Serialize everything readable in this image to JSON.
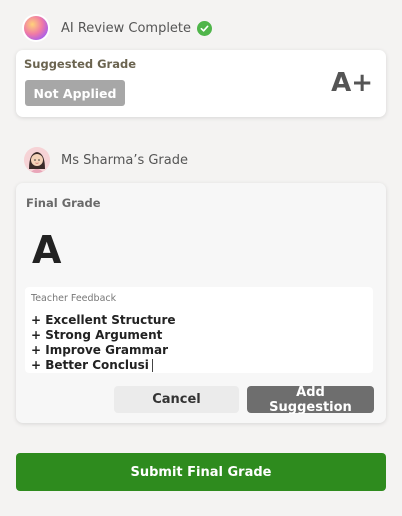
{
  "ai_review": {
    "status": "AI Review Complete"
  },
  "suggestion": {
    "label": "Suggested Grade",
    "status_badge": "Not Applied",
    "grade": "A+"
  },
  "teacher": {
    "name_label": "Ms Sharma’s Grade"
  },
  "final": {
    "label": "Final Grade",
    "grade": "A",
    "feedback_label": "Teacher Feedback",
    "feedback_lines": [
      "+ Excellent Structure",
      "+ Strong Argument",
      "+ Improve Grammar",
      "+ Better Conclusi"
    ]
  },
  "actions": {
    "cancel": "Cancel",
    "add_suggestion": "Add Suggestion",
    "submit": "Submit Final Grade"
  },
  "colors": {
    "success": "#4fb54a",
    "primary": "#2e8b1e",
    "muted_button": "#6e6e6e",
    "badge": "#a7a7a7"
  },
  "icons": {
    "ai": "ai-gradient-avatar",
    "check": "check-circle-icon",
    "teacher": "teacher-avatar"
  }
}
